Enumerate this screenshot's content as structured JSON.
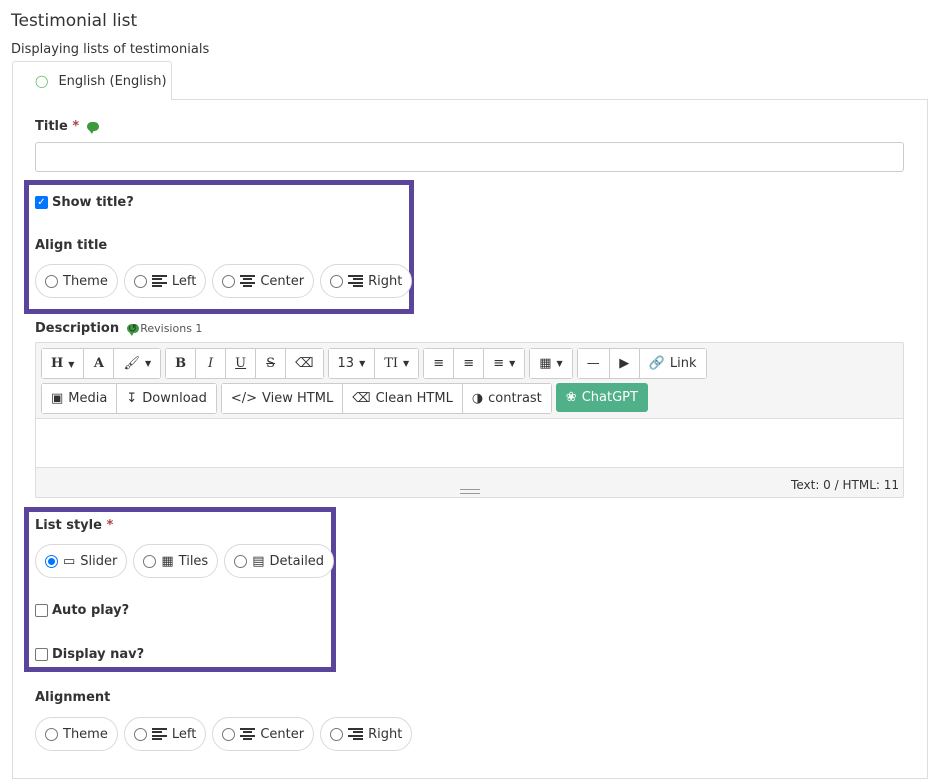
{
  "header": {
    "title": "Testimonial list",
    "subtitle": "Displaying lists of testimonials"
  },
  "tabs": [
    {
      "label": "English (English)",
      "icon": "comment-outline-icon",
      "active": true
    }
  ],
  "form": {
    "title_field": {
      "label": "Title",
      "required_mark": "*",
      "value": ""
    },
    "show_title": {
      "label": "Show title?",
      "checked": true
    },
    "align_title": {
      "label": "Align title",
      "options": [
        "Theme",
        "Left",
        "Center",
        "Right"
      ],
      "selected": null
    },
    "description": {
      "label": "Description",
      "revisions_label": "Revisions 1",
      "toolbar_row1": [
        "H",
        "A",
        "brush",
        "B",
        "I",
        "U",
        "S",
        "eraser",
        "13",
        "TI",
        "ul",
        "ol",
        "align",
        "table",
        "hr",
        "video",
        "Link"
      ],
      "toolbar_row2": [
        "Media",
        "Download",
        "View HTML",
        "Clean HTML",
        "contrast",
        "ChatGPT"
      ],
      "counter": "Text: 0 / HTML: 11"
    },
    "list_style": {
      "label": "List style",
      "required_mark": "*",
      "options": [
        "Slider",
        "Tiles",
        "Detailed"
      ],
      "selected": "Slider"
    },
    "auto_play": {
      "label": "Auto play?",
      "checked": false
    },
    "display_nav": {
      "label": "Display nav?",
      "checked": false
    },
    "alignment": {
      "label": "Alignment",
      "options": [
        "Theme",
        "Left",
        "Center",
        "Right"
      ],
      "selected": null
    }
  },
  "colors": {
    "highlight": "#5b449c",
    "chatgpt": "#4fb089",
    "comment_icon": "#3c9a3c",
    "required": "#a94442"
  }
}
